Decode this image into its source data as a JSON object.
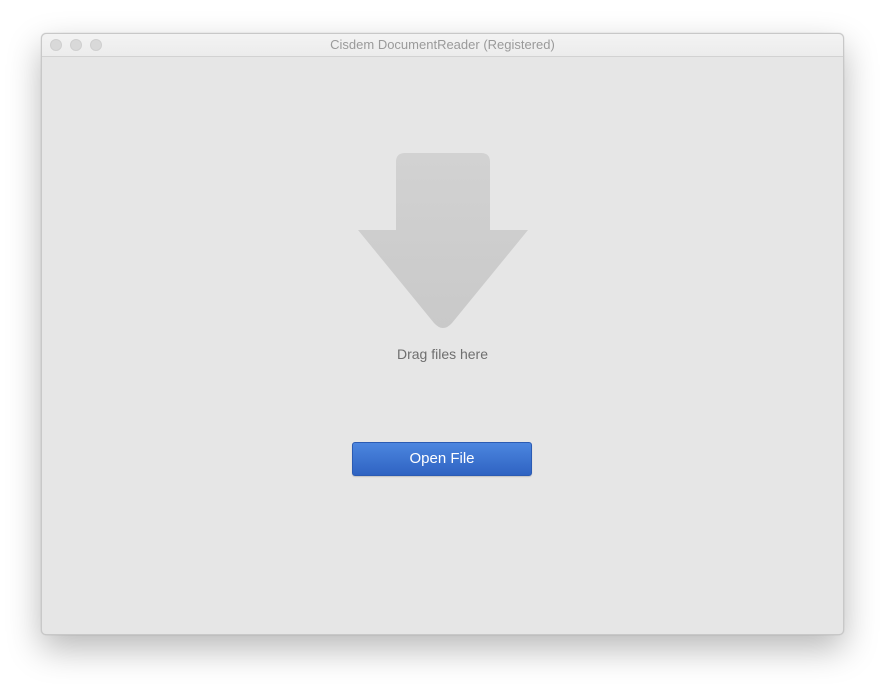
{
  "window": {
    "title": "Cisdem DocumentReader (Registered)"
  },
  "drop_zone": {
    "icon": "down-arrow-icon",
    "label": "Drag files here"
  },
  "actions": {
    "open_file_label": "Open File"
  },
  "colors": {
    "accent": "#3a73d4",
    "window_background": "#e6e6e6",
    "arrow": "#cccccc"
  }
}
